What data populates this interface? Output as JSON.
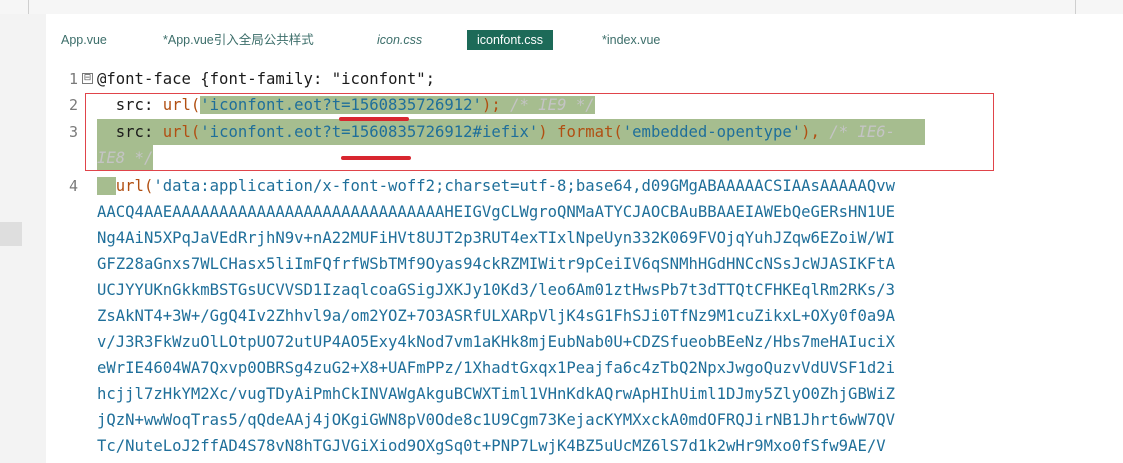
{
  "tabs": [
    {
      "label": "App.vue",
      "italic": false,
      "active": false
    },
    {
      "label": "*App.vue引入全局公共样式",
      "italic": false,
      "active": false
    },
    {
      "label": "icon.css",
      "italic": true,
      "active": false
    },
    {
      "label": "iconfont.css",
      "italic": false,
      "active": true
    },
    {
      "label": "*index.vue",
      "italic": false,
      "active": false
    }
  ],
  "editor": {
    "line_numbers": [
      "1",
      "2",
      "3",
      "4"
    ],
    "fold_glyph": "⊟",
    "line1": {
      "at": "@font-face {",
      "prop": "font-family: ",
      "val": "\"iconfont\";"
    },
    "line2": {
      "indent": "  ",
      "prop": "src: ",
      "fn": "url(",
      "str": "'iconfont.eot?t=1560835726912'",
      "close": ");",
      "comment": " /* IE9 */"
    },
    "line3": {
      "indent": "  ",
      "prop": "src: ",
      "fn": "url(",
      "str": "'iconfont.eot?t=1560835726912#iefix'",
      "close": ")",
      "fn2": " format(",
      "str2": "'embedded-opentype'",
      "close2": "),",
      "comment": " /* IE6-"
    },
    "line3b": {
      "comment": "IE8 */"
    },
    "line4": {
      "indent": "  ",
      "fn": "url(",
      "str": "'data:application/x-font-woff2;charset=utf-8;base64,d09GMgABAAAAACSIAAsAAAAAQvw"
    },
    "b64": [
      "AACQ4AAEAAAAAAAAAAAAAAAAAAAAAAAAAAAAAHEIGVgCLWgroQNMaATYCJAOCBAuBBAAEIAWEbQeGERsHN1UE",
      "Ng4AiN5XPqJaVEdRrjhN9v+nA22MUFiHVt8UJT2p3RUT4exTIxlNpeUyn332K069FVOjqYuhJZqw6EZoiW/WI",
      "GFZ28aGnxs7WLCHasx5liImFQfrfWSbTMf9Oyas94ckRZMIWitr9pCeiIV6qSNMhHGdHNCcNSsJcWJASIKFtA",
      "UCJYYUKnGkkmBSTGsUCVVSD1IzaqlcoaGSigJXKJy10Kd3/leo6Am01ztHwsPb7t3dTTQtCFHKEqlRm2RKs/3",
      "ZsAkNT4+3W+/GgQ4Iv2Zhhvl9a/om2YOZ+7O3ASRfULXARpVljK4sG1FhSJi0TfNz9M1cuZikxL+OXy0f0a9A",
      "v/J3R3FkWzuOlLOtpUO72utUP4AO5Exy4kNod7vm1aKHk8mjEubNab0U+CDZSfueobBEeNz/Hbs7meHAIuciX",
      "eWrIE4604WA7Qxvp0OBRSg4zuG2+X8+UAFmPPz/1XhadtGxqx1Peajfa6c4zTbQ2NpxJwgoQuzvVdUVSF1d2i",
      "hcjjl7zHkYM2Xc/vugTDyAiPmhCkINVAWgAkguBCWXTiml1VHnKdkAQrwApHIhUiml1DJmy5ZlyO0ZhjGBWiZ",
      "jQzN+wwWoqTras5/qQdeAAj4jOKgiGWN8pV0Ode8c1U9Cgm73KejacKYMXxckA0mdOFRQJirNB1Jhrt6wW7QV",
      "Tc/NuteLoJ2ffAD4S78vN8hTGJVGiXiod9OXgSq0t+PNP7LwjK4BZ5uUcMZ6lS7d1k2wHr9Mxo0fSfw9AE/V"
    ]
  }
}
